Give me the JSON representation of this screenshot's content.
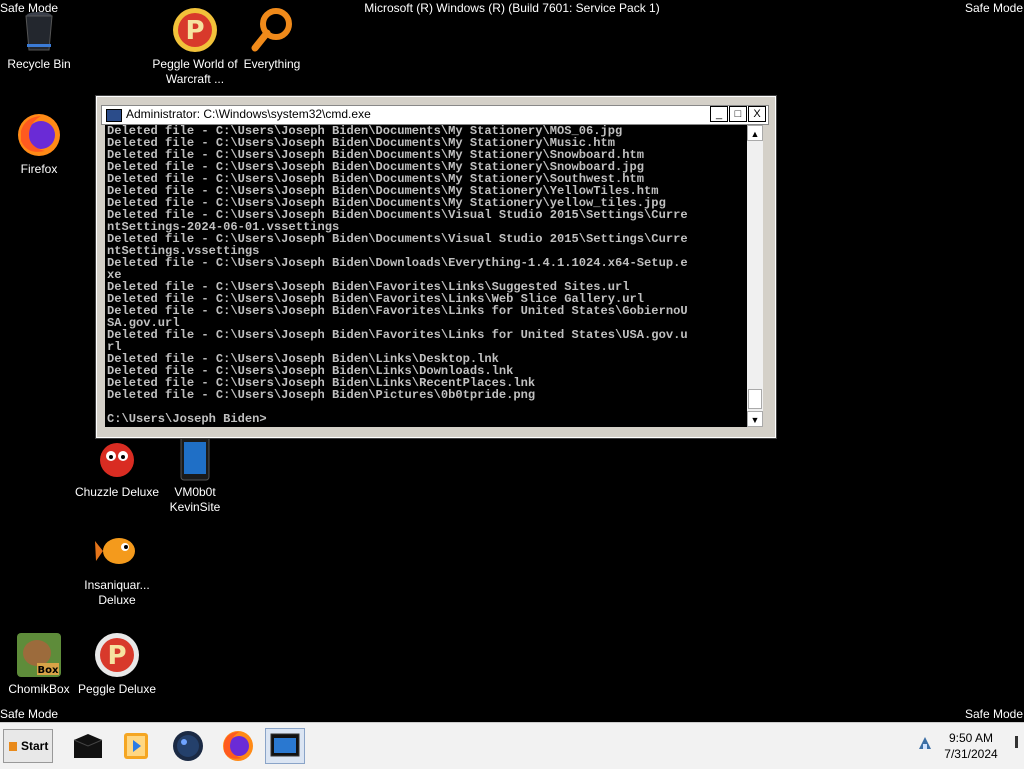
{
  "desktop": {
    "safe_mode_label": "Safe Mode",
    "os_banner": "Microsoft (R) Windows (R) (Build 7601: Service Pack 1)",
    "icons": [
      {
        "name": "Recycle Bin",
        "icon": "recycle-bin-icon"
      },
      {
        "name": "Peggle World of Warcraft ...",
        "icon": "peggle-icon"
      },
      {
        "name": "Everything",
        "icon": "magnifier-icon"
      },
      {
        "name": "Firefox",
        "icon": "firefox-icon"
      },
      {
        "name": "Chuzzle Deluxe",
        "icon": "chuzzle-icon"
      },
      {
        "name": "VM0b0t KevinSite",
        "icon": "phone-icon"
      },
      {
        "name": "Insaniquar... Deluxe",
        "icon": "fish-icon"
      },
      {
        "name": "ChomikBox",
        "icon": "chomikbox-icon"
      },
      {
        "name": "Peggle Deluxe",
        "icon": "peggle-icon"
      }
    ]
  },
  "cmd_window": {
    "title": "Administrator: C:\\Windows\\system32\\cmd.exe",
    "buttons": {
      "minimize": "_",
      "maximize": "□",
      "close": "X"
    },
    "output": "Deleted file - C:\\Users\\Joseph Biden\\Documents\\My Stationery\\MOS_06.jpg\nDeleted file - C:\\Users\\Joseph Biden\\Documents\\My Stationery\\Music.htm\nDeleted file - C:\\Users\\Joseph Biden\\Documents\\My Stationery\\Snowboard.htm\nDeleted file - C:\\Users\\Joseph Biden\\Documents\\My Stationery\\Snowboard.jpg\nDeleted file - C:\\Users\\Joseph Biden\\Documents\\My Stationery\\Southwest.htm\nDeleted file - C:\\Users\\Joseph Biden\\Documents\\My Stationery\\YellowTiles.htm\nDeleted file - C:\\Users\\Joseph Biden\\Documents\\My Stationery\\yellow_tiles.jpg\nDeleted file - C:\\Users\\Joseph Biden\\Documents\\Visual Studio 2015\\Settings\\Curre\nntSettings-2024-06-01.vssettings\nDeleted file - C:\\Users\\Joseph Biden\\Documents\\Visual Studio 2015\\Settings\\Curre\nntSettings.vssettings\nDeleted file - C:\\Users\\Joseph Biden\\Downloads\\Everything-1.4.1.1024.x64-Setup.e\nxe\nDeleted file - C:\\Users\\Joseph Biden\\Favorites\\Links\\Suggested Sites.url\nDeleted file - C:\\Users\\Joseph Biden\\Favorites\\Links\\Web Slice Gallery.url\nDeleted file - C:\\Users\\Joseph Biden\\Favorites\\Links for United States\\GobiernoU\nSA.gov.url\nDeleted file - C:\\Users\\Joseph Biden\\Favorites\\Links for United States\\USA.gov.u\nrl\nDeleted file - C:\\Users\\Joseph Biden\\Links\\Desktop.lnk\nDeleted file - C:\\Users\\Joseph Biden\\Links\\Downloads.lnk\nDeleted file - C:\\Users\\Joseph Biden\\Links\\RecentPlaces.lnk\nDeleted file - C:\\Users\\Joseph Biden\\Pictures\\0b0tpride.png\n\nC:\\Users\\Joseph Biden>"
  },
  "taskbar": {
    "start_label": "Start",
    "pinned": [
      "cmd-icon",
      "media-player-icon",
      "globe-icon",
      "firefox-icon",
      "console-window-icon"
    ],
    "clock_time": "9:50 AM",
    "clock_date": "7/31/2024"
  }
}
